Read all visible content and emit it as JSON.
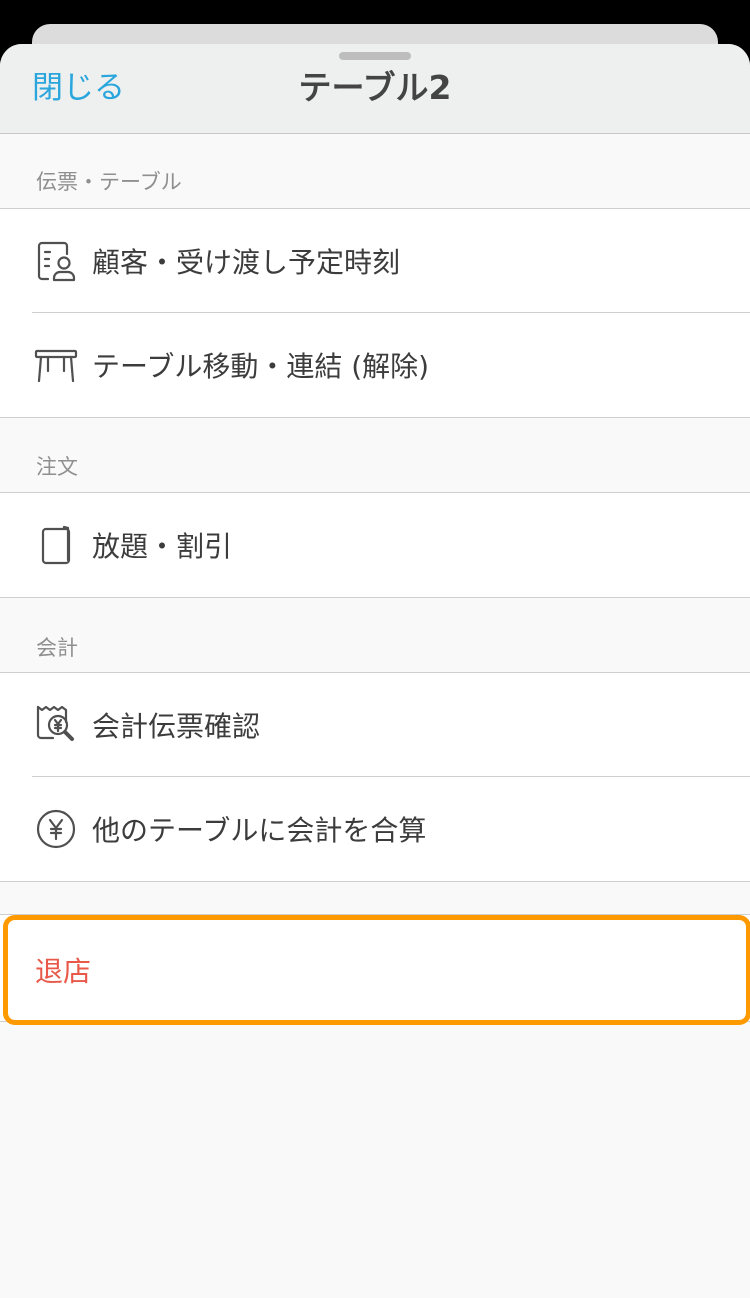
{
  "nav": {
    "close_label": "閉じる",
    "title": "テーブル2"
  },
  "sections": [
    {
      "header": "伝票・テーブル",
      "items": [
        {
          "label": "顧客・受け渡し予定時刻",
          "icon": "customer-list-icon"
        },
        {
          "label": "テーブル移動・連結 (解除)",
          "icon": "table-icon"
        }
      ]
    },
    {
      "header": "注文",
      "items": [
        {
          "label": "放題・割引",
          "icon": "menu-book-icon"
        }
      ]
    },
    {
      "header": "会計",
      "items": [
        {
          "label": "会計伝票確認",
          "icon": "receipt-search-icon"
        },
        {
          "label": "他のテーブルに会計を合算",
          "icon": "yen-circle-icon"
        }
      ]
    }
  ],
  "leave": {
    "label": "退店"
  },
  "colors": {
    "accent": "#2aa6dc",
    "destructive": "#e8594a",
    "highlight": "#ff9900"
  }
}
